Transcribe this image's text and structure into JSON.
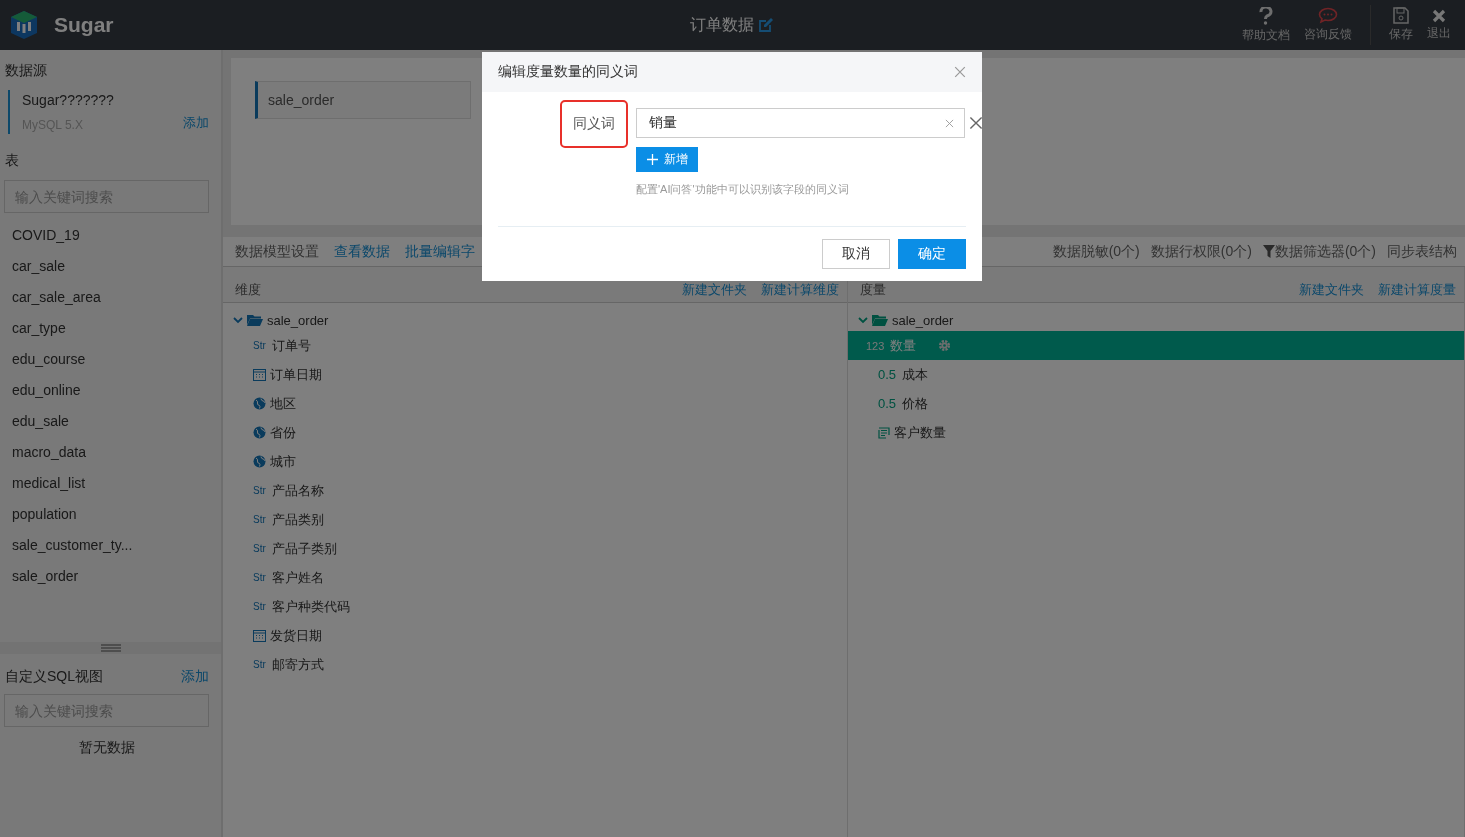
{
  "header": {
    "logo_text": "Sugar",
    "title": "订单数据",
    "actions": [
      {
        "kind": "help",
        "label": "帮助文档"
      },
      {
        "kind": "feedback",
        "label": "咨询反馈"
      },
      {
        "kind": "save",
        "label": "保存"
      },
      {
        "kind": "exit",
        "label": "退出"
      }
    ]
  },
  "sidebar": {
    "datasource_title": "数据源",
    "datasource": {
      "name": "Sugar???????",
      "version": "MySQL 5.X",
      "add_link": "添加"
    },
    "table_title": "表",
    "table_search": {
      "placeholder": "输入关键词搜索"
    },
    "tables": [
      "COVID_19",
      "car_sale",
      "car_sale_area",
      "car_type",
      "edu_course",
      "edu_online",
      "edu_sale",
      "macro_data",
      "medical_list",
      "population",
      "sale_customer_ty...",
      "sale_order"
    ],
    "sql_title": "自定义SQL视图",
    "sql_add_link": "添加",
    "sql_search": {
      "placeholder": "输入关键词搜索"
    },
    "sql_empty": "暂无数据"
  },
  "source_tab": "sale_order",
  "toolbar": {
    "left": [
      {
        "kind": "text",
        "label": "数据模型设置"
      },
      {
        "kind": "link",
        "label": "查看数据"
      },
      {
        "kind": "link",
        "label": "批量编辑字"
      }
    ],
    "right": [
      {
        "kind": "plain",
        "label": "数据脱敏(0个)"
      },
      {
        "kind": "plain",
        "label": "数据行权限(0个)"
      },
      {
        "kind": "filter",
        "label": "数据筛选器(0个)"
      },
      {
        "kind": "plain",
        "label": "同步表结构"
      }
    ]
  },
  "dimensions": {
    "title": "维度",
    "links": [
      "新建文件夹",
      "新建计算维度"
    ],
    "folder": {
      "name": "sale_order",
      "expanded": true,
      "children": [
        {
          "kind": "str",
          "badge": "Str",
          "name": "订单号"
        },
        {
          "kind": "date",
          "name": "订单日期"
        },
        {
          "kind": "geo",
          "name": "地区"
        },
        {
          "kind": "geo",
          "name": "省份"
        },
        {
          "kind": "geo",
          "name": "城市"
        },
        {
          "kind": "str",
          "badge": "Str",
          "name": "产品名称"
        },
        {
          "kind": "str",
          "badge": "Str",
          "name": "产品类别"
        },
        {
          "kind": "str",
          "badge": "Str",
          "name": "产品子类别"
        },
        {
          "kind": "str",
          "badge": "Str",
          "name": "客户姓名"
        },
        {
          "kind": "str",
          "badge": "Str",
          "name": "客户种类代码"
        },
        {
          "kind": "date",
          "name": "发货日期"
        },
        {
          "kind": "str",
          "badge": "Str",
          "name": "邮寄方式"
        }
      ]
    }
  },
  "measures": {
    "title": "度量",
    "links": [
      "新建文件夹",
      "新建计算度量"
    ],
    "folder": {
      "name": "sale_order",
      "expanded": true,
      "children": [
        {
          "kind": "int",
          "badge": "123",
          "name": "数量",
          "selected": true
        },
        {
          "kind": "float",
          "badge": "0.5",
          "name": "成本",
          "selected": false
        },
        {
          "kind": "float",
          "badge": "0.5",
          "name": "价格",
          "selected": false
        },
        {
          "kind": "count",
          "name": "客户数量",
          "selected": false
        }
      ]
    }
  },
  "dialog": {
    "title": "编辑度量数量的同义词",
    "field_label": "同义词",
    "label_highlighted": true,
    "synonyms": [
      "销量"
    ],
    "add_button": "新增",
    "hint": "配置'AI问答'功能中可以识别该字段的同义词",
    "cancel": "取消",
    "ok": "确定"
  }
}
